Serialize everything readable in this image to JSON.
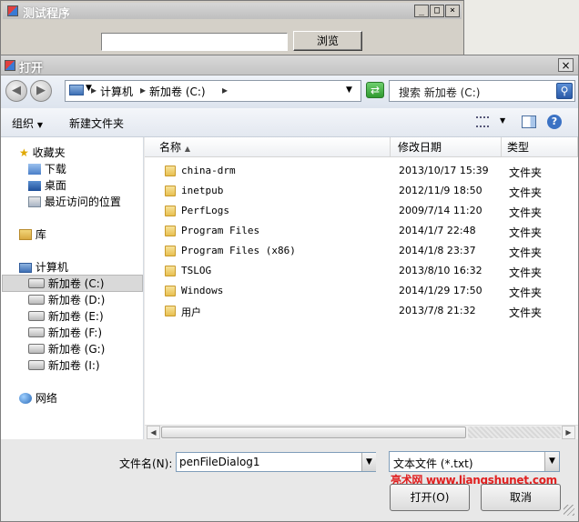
{
  "back_window": {
    "title": "测试程序",
    "input_value": "",
    "browse_button": "浏览",
    "controls": [
      "_",
      "□",
      "×"
    ]
  },
  "dialog": {
    "title": "打开",
    "close_label": "×",
    "address": {
      "computer": "计算机",
      "sep1": "▸",
      "drive": "新加卷 (C:)",
      "sep2": "▸"
    },
    "search_placeholder": "搜索 新加卷 (C:)",
    "toolbar": {
      "organize": "组织",
      "new_folder": "新建文件夹"
    },
    "sidebar": {
      "favorites": {
        "label": "收藏夹",
        "items": [
          "下载",
          "桌面",
          "最近访问的位置"
        ]
      },
      "libraries": "库",
      "computer": {
        "label": "计算机",
        "drives": [
          "新加卷 (C:)",
          "新加卷 (D:)",
          "新加卷 (E:)",
          "新加卷 (F:)",
          "新加卷 (G:)",
          "新加卷 (I:)"
        ],
        "selected_index": 0
      },
      "network": "网络"
    },
    "columns": {
      "name": "名称",
      "modified": "修改日期",
      "type": "类型"
    },
    "files": [
      {
        "name": "china-drm",
        "date": "2013/10/17 15:39",
        "type": "文件夹"
      },
      {
        "name": "inetpub",
        "date": "2012/11/9 18:50",
        "type": "文件夹"
      },
      {
        "name": "PerfLogs",
        "date": "2009/7/14 11:20",
        "type": "文件夹"
      },
      {
        "name": "Program Files",
        "date": "2014/1/7 22:48",
        "type": "文件夹"
      },
      {
        "name": "Program Files (x86)",
        "date": "2014/1/8 23:37",
        "type": "文件夹"
      },
      {
        "name": "TSLOG",
        "date": "2013/8/10 16:32",
        "type": "文件夹"
      },
      {
        "name": "Windows",
        "date": "2014/1/29 17:50",
        "type": "文件夹"
      },
      {
        "name": "用户",
        "date": "2013/7/8 21:32",
        "type": "文件夹"
      }
    ],
    "filename_label": "文件名(N):",
    "filename_value": "penFileDialog1",
    "filetype_value": "文本文件 (*.txt)",
    "open_button": "打开(O)",
    "cancel_button": "取消",
    "watermark": "亮术网 www.liangshunet.com"
  },
  "colors": {
    "selection": "#cfe3f7",
    "watermark": "#e02020"
  }
}
